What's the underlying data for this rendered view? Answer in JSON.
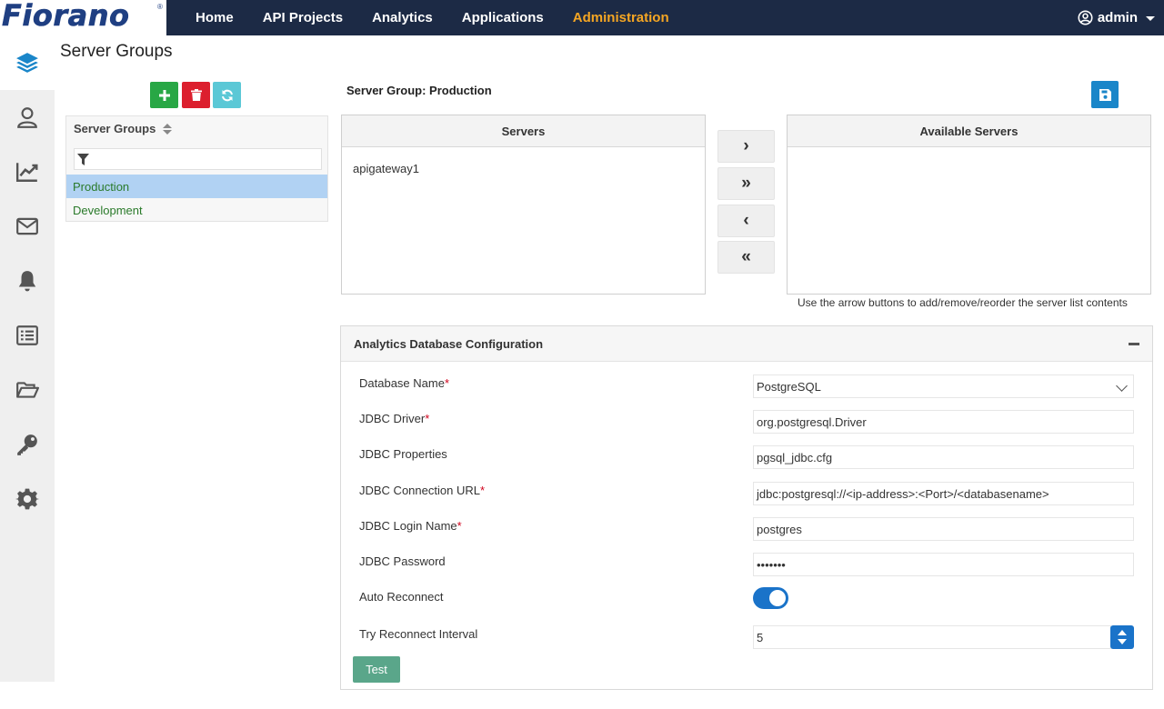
{
  "brand": {
    "logo_text": "Fiorano",
    "reg_mark": "®"
  },
  "nav": {
    "items": [
      {
        "label": "Home"
      },
      {
        "label": "API Projects"
      },
      {
        "label": "Analytics"
      },
      {
        "label": "Applications"
      },
      {
        "label": "Administration"
      }
    ],
    "active": "Administration",
    "user": "admin"
  },
  "sidebar": {
    "icons": [
      "layers-icon",
      "user-icon",
      "chart-line-icon",
      "envelope-icon",
      "bell-icon",
      "list-icon",
      "folder-open-icon",
      "key-icon",
      "gear-icon"
    ],
    "active": "layers-icon"
  },
  "page": {
    "title": "Server Groups"
  },
  "groups": {
    "header": "Server Groups",
    "filter_value": "",
    "items": [
      "Production",
      "Development"
    ],
    "selected": "Production"
  },
  "detail": {
    "server_group_label": "Server Group: Production",
    "servers_header": "Servers",
    "available_header": "Available Servers",
    "servers": [
      "apigateway1"
    ],
    "available_servers": [],
    "move_buttons": [
      "›",
      "»",
      "‹",
      "«"
    ],
    "hint": "Use the arrow buttons to add/remove/reorder the server list contents"
  },
  "config": {
    "title": "Analytics Database Configuration",
    "fields": {
      "db_name": {
        "label": "Database Name",
        "value": "PostgreSQL"
      },
      "jdbc_driver": {
        "label": "JDBC Driver",
        "value": "org.postgresql.Driver"
      },
      "jdbc_properties": {
        "label": "JDBC Properties",
        "value": "pgsql_jdbc.cfg"
      },
      "jdbc_url": {
        "label": "JDBC Connection URL",
        "value": "jdbc:postgresql://<ip-address>:<Port>/<databasename>"
      },
      "jdbc_login": {
        "label": "JDBC Login Name",
        "value": "postgres"
      },
      "jdbc_password": {
        "label": "JDBC Password",
        "value": "•••••••"
      },
      "auto_reconnect": {
        "label": "Auto Reconnect",
        "enabled": true
      },
      "reconnect_interval": {
        "label": "Try Reconnect Interval",
        "value": "5"
      }
    },
    "test_label": "Test"
  },
  "colors": {
    "navbar": "#1c2a45",
    "nav_active": "#f5a623",
    "add_button": "#28a745",
    "delete_button": "#dc1f2e",
    "refresh_button": "#5bc8d6",
    "save_button": "#1a86c9",
    "selected_row": "#b1d2f3",
    "group_text": "#2a7a2a",
    "toggle_on": "#1a73c9",
    "test_button": "#5aa68a",
    "required_mark": "#d0021b"
  }
}
